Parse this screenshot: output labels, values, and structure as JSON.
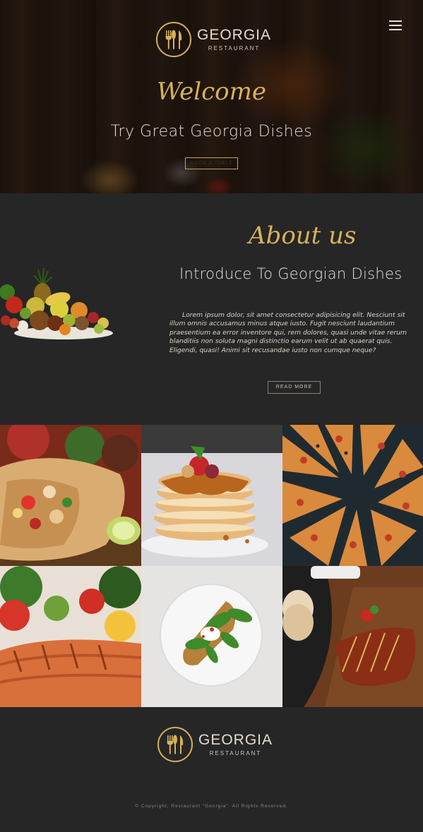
{
  "header": {
    "logo": {
      "name": "GEORGIA",
      "sub": "RESTAURANT"
    },
    "menu_icon": "hamburger-menu-icon"
  },
  "hero": {
    "welcome": "Welcome",
    "subtitle": "Try Great Georgia Dishes",
    "button_label": "BOOK A TABLE"
  },
  "about": {
    "title": "About us",
    "subtitle": "Introduce To Georgian Dishes",
    "text": "Lorem ipsum dolor, sit amet consectetur adipisicing elit. Nesciunt sit illum omnis accusamus minus atque iusto. Fugit nesciunt laudantium praesentium ea error inventore qui, rem dolores, quasi unde vitae rerum blanditiis non soluta magni distinctio earum velit ut ab quaerat quis. Eligendi, quasi! Animi sit recusandae iusto non cumque neque?",
    "button_label": "READ MORE"
  },
  "gallery": {
    "items": [
      "burrito",
      "pancakes",
      "pizza",
      "salmon",
      "avocado-toast",
      "grilled-meat"
    ]
  },
  "footer": {
    "logo": {
      "name": "GEORGIA",
      "sub": "RESTAURANT"
    },
    "copyright": "© Copyright, Restaurant \"Georgia\". All Rights Reserved."
  },
  "colors": {
    "accent": "#d6b25c",
    "background": "#262626",
    "text": "#e8e1d5"
  }
}
